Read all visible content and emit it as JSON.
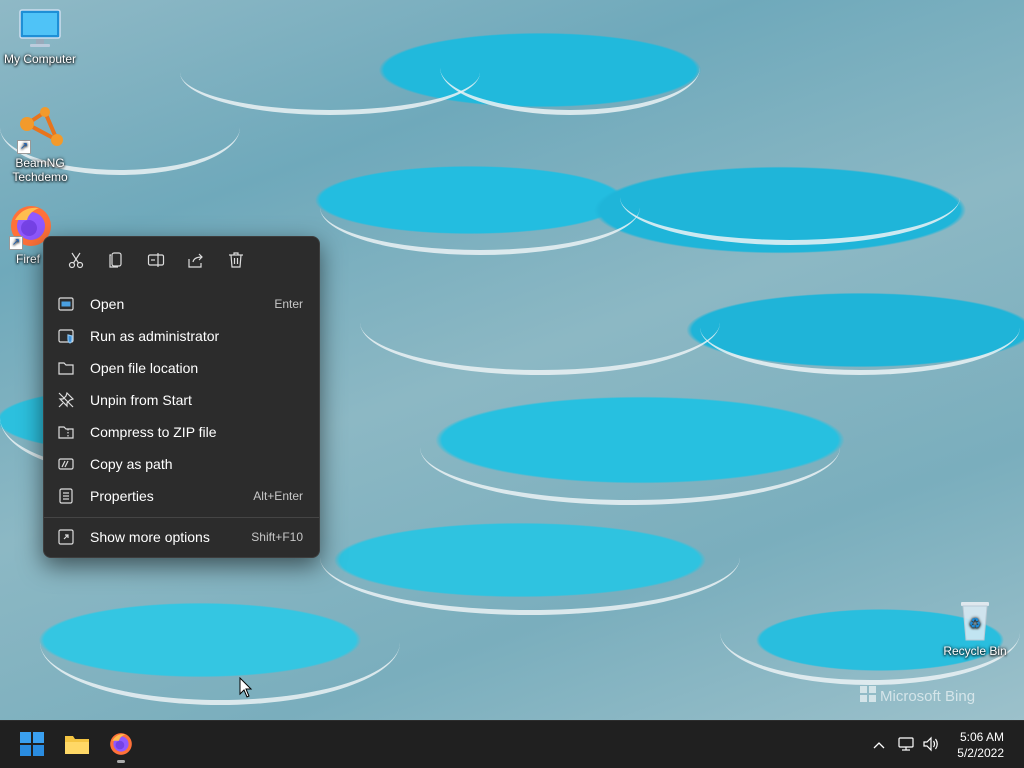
{
  "desktop": {
    "icons": [
      {
        "label": "My Computer",
        "icon": "monitor-icon"
      },
      {
        "label": "BeamNG\nTechdemo",
        "icon": "beamng-icon"
      },
      {
        "label": "Firef",
        "icon": "firefox-icon"
      },
      {
        "label": "Recycle Bin",
        "icon": "recycle-bin-icon"
      }
    ],
    "watermark": "Microsoft Bing"
  },
  "context_menu": {
    "toolbar": [
      {
        "name": "cut",
        "icon": "scissors-icon"
      },
      {
        "name": "copy",
        "icon": "copy-icon"
      },
      {
        "name": "rename",
        "icon": "rename-icon"
      },
      {
        "name": "share",
        "icon": "share-icon"
      },
      {
        "name": "delete",
        "icon": "trash-icon"
      }
    ],
    "items": [
      {
        "label": "Open",
        "shortcut": "Enter",
        "icon": "open-icon"
      },
      {
        "label": "Run as administrator",
        "shortcut": "",
        "icon": "admin-shield-icon"
      },
      {
        "label": "Open file location",
        "shortcut": "",
        "icon": "folder-icon"
      },
      {
        "label": "Unpin from Start",
        "shortcut": "",
        "icon": "unpin-icon"
      },
      {
        "label": "Compress to ZIP file",
        "shortcut": "",
        "icon": "zip-folder-icon"
      },
      {
        "label": "Copy as path",
        "shortcut": "",
        "icon": "path-icon"
      },
      {
        "label": "Properties",
        "shortcut": "Alt+Enter",
        "icon": "properties-icon"
      },
      {
        "label": "Show more options",
        "shortcut": "Shift+F10",
        "icon": "more-options-icon"
      }
    ]
  },
  "taskbar": {
    "apps": [
      {
        "name": "Start",
        "icon": "windows-start-icon"
      },
      {
        "name": "File Explorer",
        "icon": "file-explorer-icon"
      },
      {
        "name": "Firefox",
        "icon": "firefox-icon",
        "running": true
      }
    ],
    "tray": {
      "icons": [
        "chevron-up-icon",
        "network-icon",
        "volume-icon"
      ]
    },
    "clock": {
      "time": "5:06 AM",
      "date": "5/2/2022"
    }
  },
  "colors": {
    "menu_bg": "#2c2c2c",
    "taskbar_bg": "#202020",
    "accent": "#0078d4"
  }
}
